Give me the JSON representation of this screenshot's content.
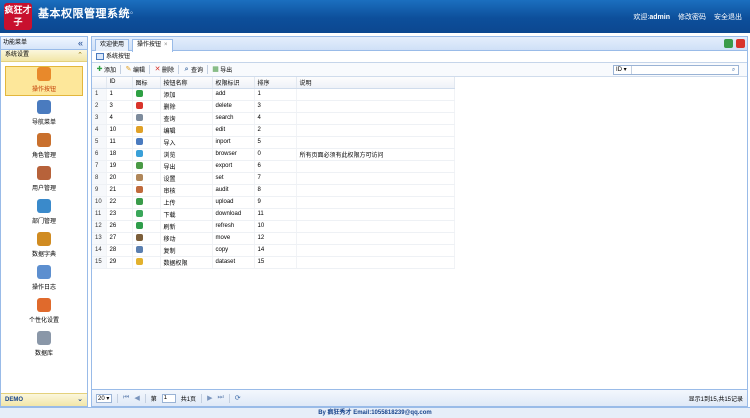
{
  "header": {
    "logo_text": "疯狂才子",
    "title": "基本权限管理系统",
    "version": "v1.0",
    "welcome": "欢迎:",
    "user": "admin",
    "my_info": "修改密码",
    "logout": "安全退出"
  },
  "sidebar": {
    "title": "功能菜单",
    "group": "系统设置",
    "footer": "DEMO",
    "items": [
      {
        "label": "操作按钮",
        "icon": "gear-icon",
        "color": "#e8892b"
      },
      {
        "label": "导航菜单",
        "icon": "menu-icon",
        "color": "#4a7bbf"
      },
      {
        "label": "角色管理",
        "icon": "users-icon",
        "color": "#c9702d"
      },
      {
        "label": "用户管理",
        "icon": "user-icon",
        "color": "#b7623a"
      },
      {
        "label": "部门管理",
        "icon": "org-icon",
        "color": "#3a8acb"
      },
      {
        "label": "数据字典",
        "icon": "book-icon",
        "color": "#d08b21"
      },
      {
        "label": "操作日志",
        "icon": "log-icon",
        "color": "#5d8fcf"
      },
      {
        "label": "个性化设置",
        "icon": "palette-icon",
        "color": "#e06a2c"
      },
      {
        "label": "数据库",
        "icon": "database-icon",
        "color": "#8a97a8"
      }
    ]
  },
  "tabs": [
    {
      "label": "欢迎使用"
    },
    {
      "label": "操作按钮",
      "close": "×"
    }
  ],
  "panel_title": "系统按钮",
  "toolbar": {
    "add": "添加",
    "edit": "编辑",
    "delete": "删除",
    "query": "查询",
    "export": "导出",
    "search_field": "ID",
    "search_placeholder": ""
  },
  "grid": {
    "columns": [
      "ID",
      "图标",
      "按钮名称",
      "权限标识",
      "排序",
      "说明"
    ],
    "rows": [
      {
        "n": "1",
        "id": "1",
        "name": "添加",
        "code": "add",
        "sort": "1",
        "note": "",
        "icon": "#2ea043"
      },
      {
        "n": "2",
        "id": "3",
        "name": "删除",
        "code": "delete",
        "sort": "3",
        "note": "",
        "icon": "#d9342b"
      },
      {
        "n": "3",
        "id": "4",
        "name": "查询",
        "code": "search",
        "sort": "4",
        "note": "",
        "icon": "#7d8b9c"
      },
      {
        "n": "4",
        "id": "10",
        "name": "编辑",
        "code": "edit",
        "sort": "2",
        "note": "",
        "icon": "#e0a127"
      },
      {
        "n": "5",
        "id": "11",
        "name": "导入",
        "code": "inport",
        "sort": "5",
        "note": "",
        "icon": "#4a7bbf"
      },
      {
        "n": "6",
        "id": "18",
        "name": "浏览",
        "code": "browser",
        "sort": "0",
        "note": "所有页面必须有此权限方可访问",
        "icon": "#3aa0d8"
      },
      {
        "n": "7",
        "id": "19",
        "name": "导出",
        "code": "export",
        "sort": "6",
        "note": "",
        "icon": "#4a9a45"
      },
      {
        "n": "8",
        "id": "20",
        "name": "设置",
        "code": "set",
        "sort": "7",
        "note": "",
        "icon": "#b0875a"
      },
      {
        "n": "9",
        "id": "21",
        "name": "审核",
        "code": "audit",
        "sort": "8",
        "note": "",
        "icon": "#c06a3c"
      },
      {
        "n": "10",
        "id": "22",
        "name": "上传",
        "code": "upload",
        "sort": "9",
        "note": "",
        "icon": "#3a9b4a"
      },
      {
        "n": "11",
        "id": "23",
        "name": "下载",
        "code": "download",
        "sort": "11",
        "note": "",
        "icon": "#3aa75a"
      },
      {
        "n": "12",
        "id": "26",
        "name": "刷新",
        "code": "refresh",
        "sort": "10",
        "note": "",
        "icon": "#2e9d4a"
      },
      {
        "n": "13",
        "id": "27",
        "name": "移动",
        "code": "move",
        "sort": "12",
        "note": "",
        "icon": "#7b5e3a"
      },
      {
        "n": "14",
        "id": "28",
        "name": "复制",
        "code": "copy",
        "sort": "14",
        "note": "",
        "icon": "#5a7fb0"
      },
      {
        "n": "15",
        "id": "29",
        "name": "数据权限",
        "code": "dataset",
        "sort": "15",
        "note": "",
        "icon": "#e2b12d"
      }
    ]
  },
  "pager": {
    "page_size": "20",
    "page_label": "第",
    "page": "1",
    "total_pages": "共1页",
    "info": "显示1到15,共15记录"
  },
  "footer": {
    "text": "By 疯狂秀才 Email:1055818239@qq.com"
  }
}
